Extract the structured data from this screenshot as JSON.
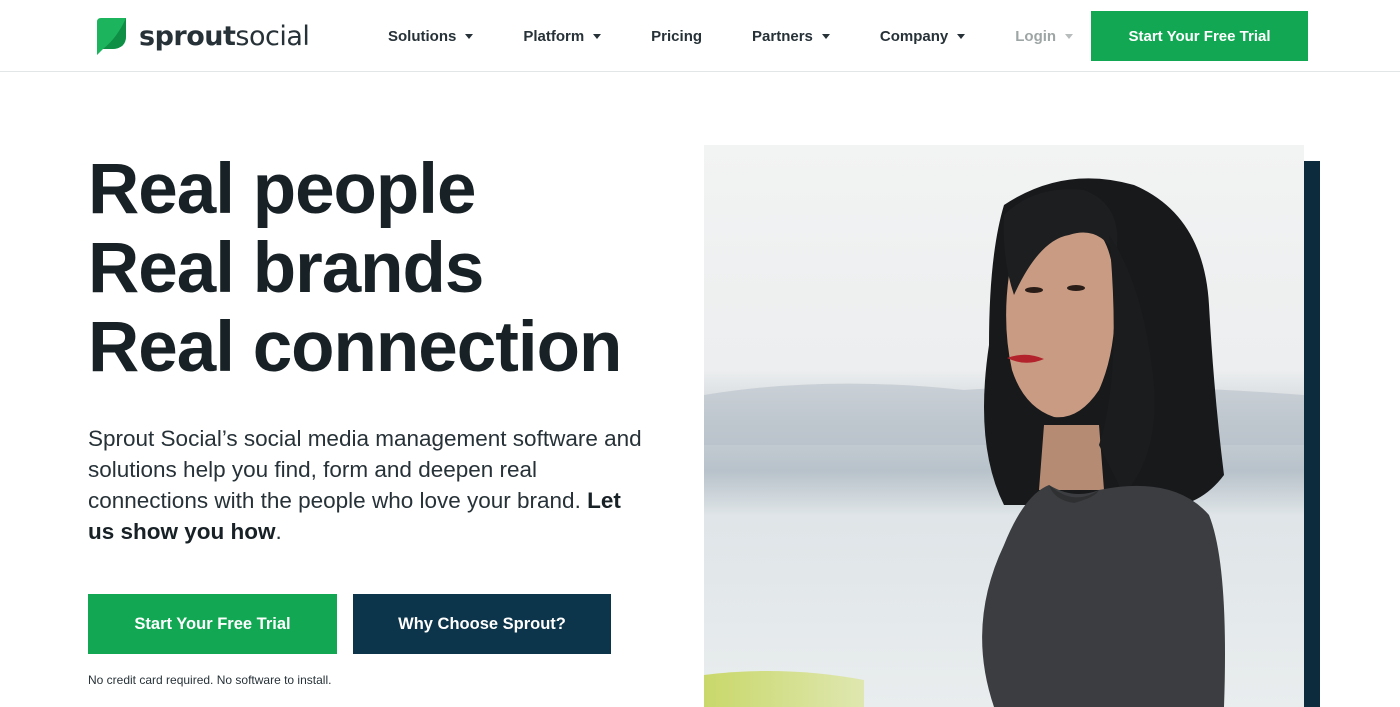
{
  "brand": {
    "logo_part1": "sprout",
    "logo_part2": "social",
    "accent_green": "#12a853",
    "accent_navy": "#0c344a"
  },
  "nav": {
    "items": [
      {
        "label": "Solutions",
        "has_dropdown": true
      },
      {
        "label": "Platform",
        "has_dropdown": true
      },
      {
        "label": "Pricing",
        "has_dropdown": false
      },
      {
        "label": "Partners",
        "has_dropdown": true
      },
      {
        "label": "Company",
        "has_dropdown": true
      }
    ],
    "login": "Login",
    "cta": "Start Your Free Trial"
  },
  "hero": {
    "headline": [
      "Real people",
      "Real brands",
      "Real connection"
    ],
    "subtext": "Sprout Social’s social media management software and solutions help you find, form and deepen real connections with the people who love your brand.",
    "subtext_bold": "Let us show you how",
    "subtext_end": ".",
    "primary_button": "Start Your Free Trial",
    "secondary_button": "Why Choose Sprout?",
    "note": "No credit card required. No software to install."
  },
  "photo": {
    "icon": "portrait-photo"
  }
}
